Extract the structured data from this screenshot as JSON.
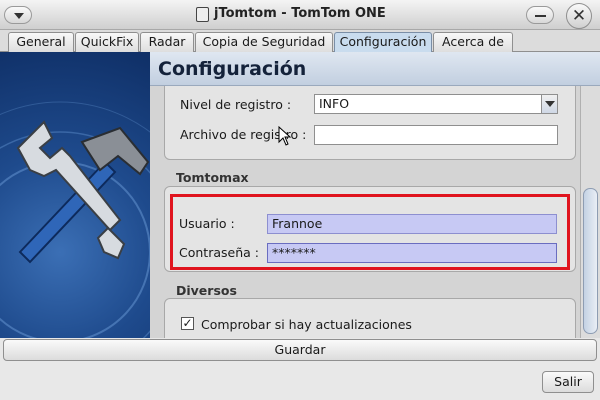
{
  "window": {
    "title": "jTomtom - TomTom ONE"
  },
  "tabs": [
    {
      "label": "General"
    },
    {
      "label": "QuickFix"
    },
    {
      "label": "Radar"
    },
    {
      "label": "Copia de Seguridad"
    },
    {
      "label": "Configuración",
      "active": true
    },
    {
      "label": "Acerca de"
    }
  ],
  "header": {
    "title": "Configuración"
  },
  "logging": {
    "level_label": "Nivel de registro :",
    "level_value": "INFO",
    "file_label": "Archivo de registro :",
    "file_value": ""
  },
  "tomtomax": {
    "section_title": "Tomtomax",
    "user_label": "Usuario :",
    "user_value": "Frannoe",
    "password_label": "Contraseña :",
    "password_value": "*******"
  },
  "diversos": {
    "section_title": "Diversos",
    "check_updates_label": "Comprobar si hay actualizaciones",
    "check_updates_checked": true
  },
  "buttons": {
    "save": "Guardar",
    "exit": "Salir"
  },
  "colors": {
    "highlight_border": "#e0141e",
    "field_fill": "#c7c9f4",
    "banner": "#1e4a8c",
    "active_tab": "#c9dcee"
  },
  "icons": {
    "window_menu": "chevron-down-icon",
    "minimize": "minimize-icon",
    "close": "close-icon",
    "app": "app-icon",
    "banner": "wrench-hammer-icon",
    "checkbox": "checkmark-icon",
    "cursor": "mouse-pointer-icon"
  }
}
